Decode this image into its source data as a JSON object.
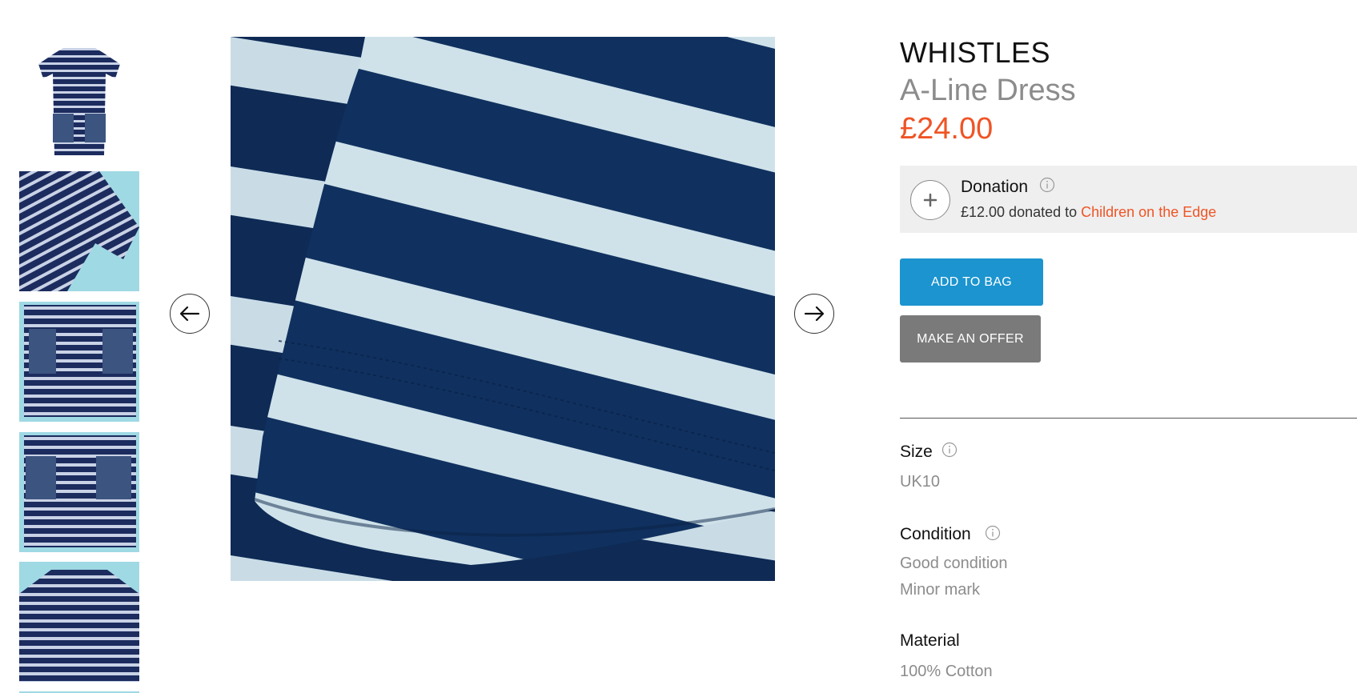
{
  "product": {
    "brand": "WHISTLES",
    "title": "A-Line Dress",
    "price": "£24.00"
  },
  "donation": {
    "title": "Donation",
    "amount_text": "£12.00 donated to ",
    "charity": "Children on the Edge",
    "plus_icon": "plus-icon",
    "info_icon": "info-icon"
  },
  "actions": {
    "add_to_bag": "ADD TO BAG",
    "make_offer": "MAKE AN OFFER"
  },
  "attributes": {
    "size_label": "Size",
    "size_value": "UK10",
    "condition_label": "Condition",
    "condition_values": [
      "Good condition",
      "Minor mark"
    ],
    "material_label": "Material",
    "material_value": "100% Cotton"
  },
  "gallery": {
    "thumbnail_count_visible": 6,
    "prev_icon": "arrow-left-icon",
    "next_icon": "arrow-right-icon"
  },
  "colors": {
    "price": "#ef5425",
    "add_to_bag": "#1b94cf",
    "make_offer": "#7a7a7a",
    "navy": "#0e2a55",
    "stripe": "#c9dce6",
    "thumb_bg": "#9fd9e4"
  }
}
